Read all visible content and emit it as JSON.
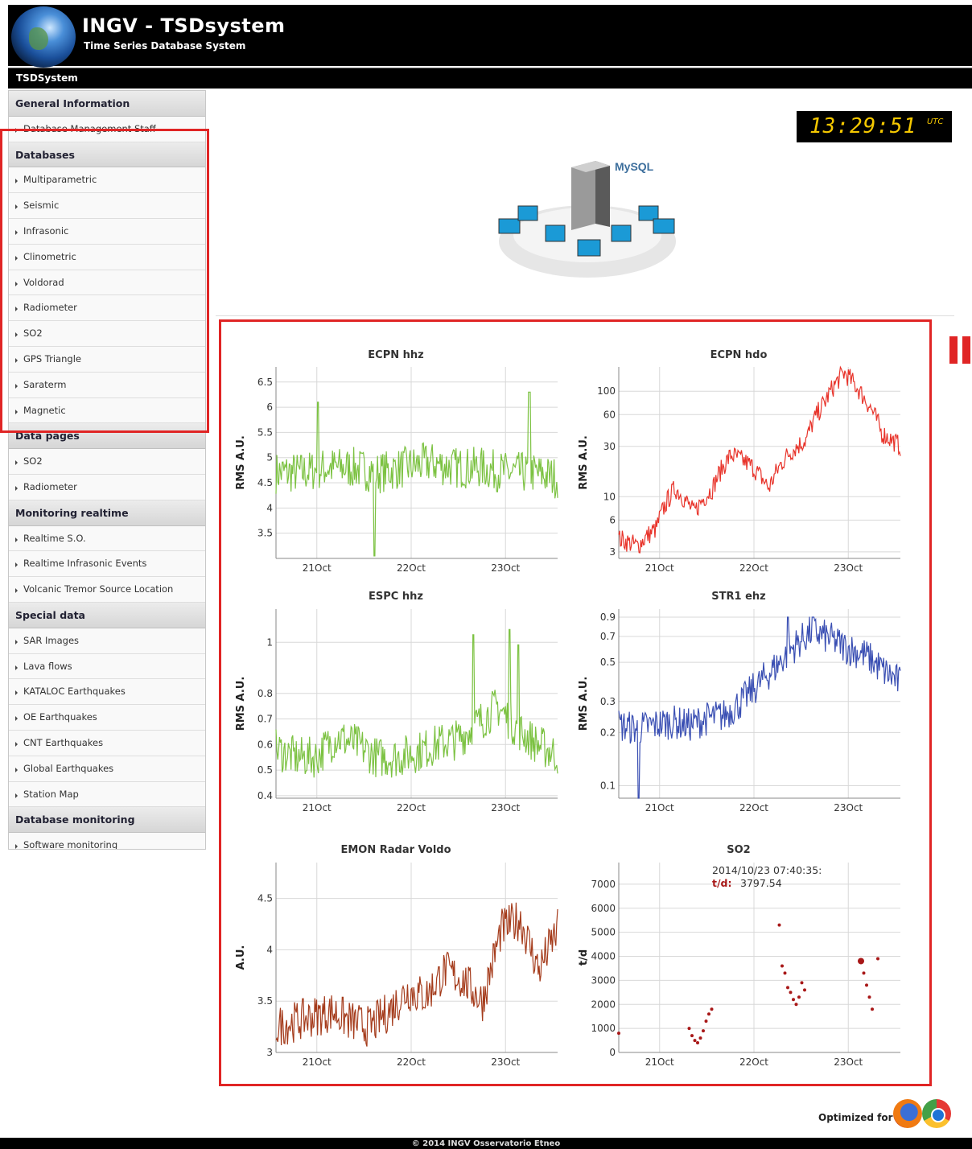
{
  "header": {
    "title": "INGV - TSDsystem",
    "subtitle": "Time Series Database System",
    "breadcrumb": "TSDSystem"
  },
  "sidebar": [
    {
      "heading": "General Information",
      "items": [
        "Database Management Staff"
      ]
    },
    {
      "heading": "Databases",
      "items": [
        "Multiparametric",
        "Seismic",
        "Infrasonic",
        "Clinometric",
        "Voldorad",
        "Radiometer",
        "SO2",
        "GPS Triangle",
        "Saraterm",
        "Magnetic"
      ]
    },
    {
      "heading": "Data pages",
      "items": [
        "SO2",
        "Radiometer"
      ]
    },
    {
      "heading": "Monitoring realtime",
      "items": [
        "Realtime S.O.",
        "Realtime Infrasonic Events",
        "Volcanic Tremor Source Location"
      ]
    },
    {
      "heading": "Special data",
      "items": [
        "SAR Images",
        "Lava flows",
        "KATALOC Earthquakes",
        "OE Earthquakes",
        "CNT Earthquakes",
        "Global Earthquakes",
        "Station Map"
      ]
    },
    {
      "heading": "Database monitoring",
      "items": [
        "Software monitoring"
      ]
    }
  ],
  "clock": {
    "time": "13:29:51",
    "zone": "UTC"
  },
  "illustration": {
    "mysql_label": "MySQL"
  },
  "colors": {
    "accent": "#e02525",
    "green": "#7cc242",
    "red": "#e8332a",
    "blue": "#3a4fb3",
    "brown": "#a53c1c",
    "dark_red": "#a81818"
  },
  "footer": {
    "optimized_label": "Optimized for",
    "copyright": "© 2014 INGV Osservatorio Etneo",
    "browser_icons": [
      "firefox-icon",
      "chrome-icon"
    ]
  },
  "chart_data": [
    {
      "type": "line",
      "title": "ECPN hhz",
      "ylabel": "RMS A.U.",
      "color": "#7cc242",
      "scale": "linear",
      "x_ticks": [
        "21Oct",
        "22Oct",
        "23Oct"
      ],
      "y_ticks": [
        3.5,
        4,
        4.5,
        5,
        5.5,
        6,
        6.5
      ],
      "ylim": [
        3,
        6.8
      ],
      "series": {
        "trend": [
          4.7,
          4.7,
          4.8,
          4.8,
          4.7,
          4.8,
          4.9,
          4.8,
          4.8,
          4.7,
          4.7,
          4.6
        ],
        "spikes": [
          [
            0.15,
            6.1
          ],
          [
            0.35,
            6.3
          ],
          [
            0.35,
            3.05
          ],
          [
            0.9,
            6.3
          ]
        ]
      }
    },
    {
      "type": "line",
      "title": "ECPN hdo",
      "ylabel": "RMS A.U.",
      "color": "#e8332a",
      "scale": "log",
      "x_ticks": [
        "21Oct",
        "22Oct",
        "23Oct"
      ],
      "y_ticks": [
        3,
        6,
        10,
        30,
        60,
        100
      ],
      "ylim": [
        2.6,
        170
      ],
      "series": {
        "trend": [
          4,
          3.4,
          5,
          12,
          7,
          12,
          25,
          20,
          12,
          25,
          35,
          80,
          150,
          90,
          40,
          30
        ]
      }
    },
    {
      "type": "line",
      "title": "ESPC hhz",
      "ylabel": "RMS A.U.",
      "color": "#7cc242",
      "scale": "linear",
      "x_ticks": [
        "21Oct",
        "22Oct",
        "23Oct"
      ],
      "y_ticks": [
        0.4,
        0.5,
        0.6,
        0.7,
        0.8,
        1
      ],
      "ylim": [
        0.39,
        1.13
      ],
      "series": {
        "trend": [
          0.58,
          0.55,
          0.55,
          0.63,
          0.6,
          0.55,
          0.55,
          0.57,
          0.6,
          0.62,
          0.68,
          0.75,
          0.66,
          0.6,
          0.56
        ],
        "spikes": [
          [
            0.7,
            1.03
          ],
          [
            0.83,
            1.05
          ],
          [
            0.86,
            0.99
          ]
        ]
      }
    },
    {
      "type": "line",
      "title": "STR1 ehz",
      "ylabel": "RMS A.U.",
      "color": "#3a4fb3",
      "scale": "log",
      "x_ticks": [
        "21Oct",
        "22Oct",
        "23Oct"
      ],
      "y_ticks": [
        0.1,
        0.2,
        0.3,
        0.5,
        0.7,
        0.9
      ],
      "ylim": [
        0.085,
        1.0
      ],
      "series": {
        "trend": [
          0.22,
          0.21,
          0.22,
          0.23,
          0.22,
          0.24,
          0.25,
          0.3,
          0.38,
          0.48,
          0.62,
          0.75,
          0.68,
          0.6,
          0.55,
          0.45,
          0.38
        ],
        "spikes": [
          [
            0.6,
            0.9
          ],
          [
            0.69,
            0.9
          ],
          [
            0.07,
            0.085
          ]
        ]
      }
    },
    {
      "type": "line",
      "title": "EMON Radar Voldo",
      "ylabel": "A.U.",
      "color": "#a53c1c",
      "scale": "linear",
      "x_ticks": [
        "21Oct",
        "22Oct",
        "23Oct"
      ],
      "y_ticks": [
        3,
        3.5,
        4,
        4.5
      ],
      "ylim": [
        3.0,
        4.85
      ],
      "series": {
        "trend": [
          3.25,
          3.3,
          3.35,
          3.4,
          3.3,
          3.25,
          3.4,
          3.6,
          3.55,
          3.8,
          3.7,
          3.5,
          4.2,
          4.3,
          3.8,
          4.2
        ]
      }
    },
    {
      "type": "scatter",
      "title": "SO2",
      "ylabel": "t/d",
      "color": "#a81818",
      "scale": "linear",
      "x_ticks": [
        "21Oct",
        "22Oct",
        "23Oct"
      ],
      "y_ticks": [
        0,
        1000,
        2000,
        3000,
        4000,
        5000,
        6000,
        7000
      ],
      "ylim": [
        0,
        7900
      ],
      "tooltip": {
        "date": "2014/10/23 07:40:35:",
        "label": "t/d:",
        "value": "3797.54"
      },
      "points": [
        [
          0.0,
          800
        ],
        [
          0.25,
          1000
        ],
        [
          0.26,
          700
        ],
        [
          0.27,
          500
        ],
        [
          0.28,
          400
        ],
        [
          0.29,
          600
        ],
        [
          0.3,
          900
        ],
        [
          0.31,
          1300
        ],
        [
          0.32,
          1600
        ],
        [
          0.33,
          1800
        ],
        [
          0.57,
          5300
        ],
        [
          0.58,
          3600
        ],
        [
          0.59,
          3300
        ],
        [
          0.6,
          2700
        ],
        [
          0.61,
          2500
        ],
        [
          0.62,
          2200
        ],
        [
          0.63,
          2000
        ],
        [
          0.64,
          2300
        ],
        [
          0.65,
          2900
        ],
        [
          0.66,
          2600
        ],
        [
          0.86,
          3800
        ],
        [
          0.87,
          3300
        ],
        [
          0.88,
          2800
        ],
        [
          0.89,
          2300
        ],
        [
          0.9,
          1800
        ],
        [
          0.92,
          3900
        ]
      ]
    }
  ]
}
